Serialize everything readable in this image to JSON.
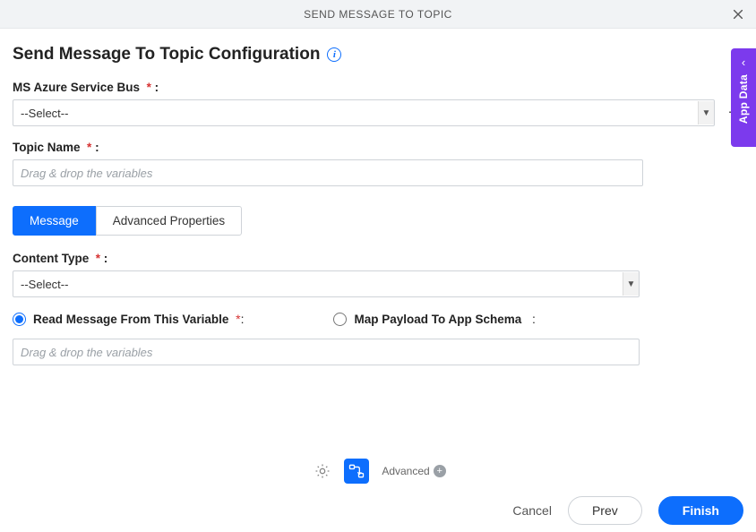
{
  "titlebar": {
    "title": "SEND MESSAGE TO TOPIC"
  },
  "heading": "Send Message To Topic Configuration",
  "fields": {
    "service_bus": {
      "label": "MS Azure Service Bus",
      "value": "--Select--"
    },
    "topic_name": {
      "label": "Topic Name",
      "placeholder": "Drag & drop the variables"
    },
    "content_type": {
      "label": "Content Type",
      "value": "--Select--"
    },
    "variable_input": {
      "placeholder": "Drag & drop the variables"
    }
  },
  "tabs": {
    "message": "Message",
    "advanced": "Advanced Properties"
  },
  "radios": {
    "read_var": "Read Message From This Variable",
    "map_schema": "Map Payload To App Schema"
  },
  "side_tab": "App Data",
  "toolbar": {
    "advanced_label": "Advanced"
  },
  "footer": {
    "cancel": "Cancel",
    "prev": "Prev",
    "finish": "Finish"
  },
  "colon": ":"
}
